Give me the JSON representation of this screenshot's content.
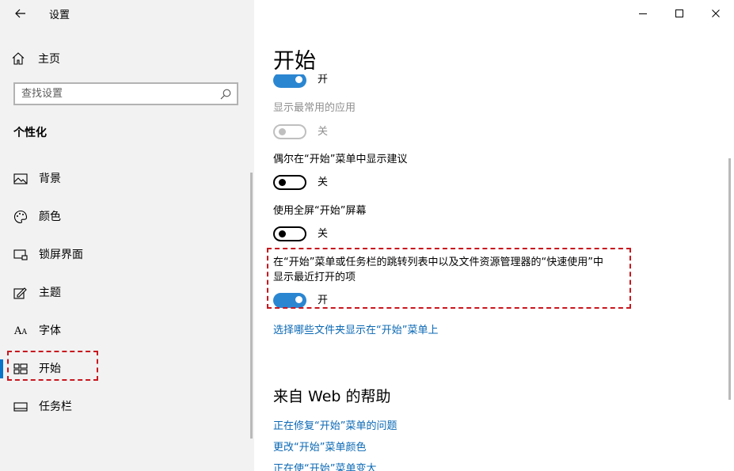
{
  "window": {
    "title": "设置",
    "controls": [
      "minimize",
      "maximize",
      "close"
    ]
  },
  "sidebar": {
    "home_label": "主页",
    "search": {
      "placeholder": "查找设置",
      "value": ""
    },
    "section_heading": "个性化",
    "items": [
      {
        "label": "背景",
        "icon": "picture-icon"
      },
      {
        "label": "颜色",
        "icon": "palette-icon"
      },
      {
        "label": "锁屏界面",
        "icon": "lock-screen-icon"
      },
      {
        "label": "主题",
        "icon": "theme-brush-icon"
      },
      {
        "label": "字体",
        "icon": "font-icon",
        "glyph": "A"
      },
      {
        "label": "开始",
        "icon": "start-grid-icon",
        "active": true
      },
      {
        "label": "任务栏",
        "icon": "taskbar-icon"
      }
    ]
  },
  "main": {
    "title": "开始",
    "settings": [
      {
        "label": "",
        "state": "on",
        "state_label": "开"
      },
      {
        "label": "显示最常用的应用",
        "state": "off",
        "state_label": "关",
        "disabled": true
      },
      {
        "label": "偶尔在“开始”菜单中显示建议",
        "state": "off",
        "state_label": "关"
      },
      {
        "label": "使用全屏“开始”屏幕",
        "state": "off",
        "state_label": "关"
      },
      {
        "label_line1": "在“开始”菜单或任务栏的跳转列表中以及文件资源管理器的“快速使用”中",
        "label_line2": "显示最近打开的项",
        "state": "on",
        "state_label": "开",
        "highlighted": true
      }
    ],
    "folders_link": "选择哪些文件夹显示在“开始”菜单上",
    "web_help": {
      "title": "来自 Web 的帮助",
      "links": [
        "正在修复“开始”菜单的问题",
        "更改“开始”菜单颜色",
        "正在使“开始”菜单变大"
      ]
    }
  },
  "colors": {
    "accent": "#2b86d1",
    "link": "#0a68b4",
    "highlight_dashed": "#c8171e",
    "sidebar_bg": "#f2f2f2"
  }
}
